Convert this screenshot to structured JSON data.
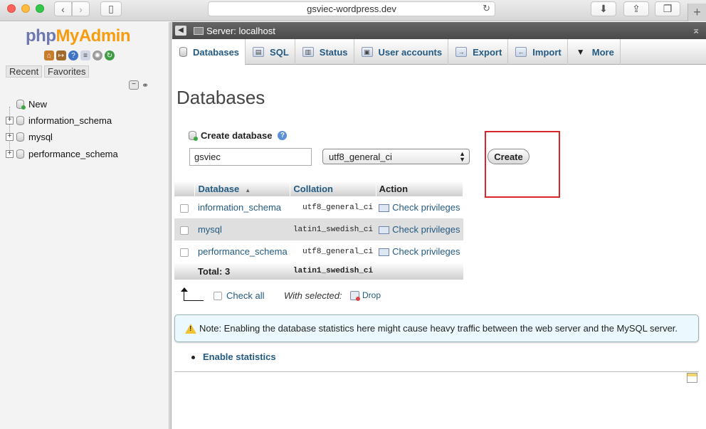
{
  "browser": {
    "url": "gsviec-wordpress.dev"
  },
  "nav": {
    "logo_php": "php",
    "logo_admin": "MyAdmin",
    "tab_recent": "Recent",
    "tab_favorites": "Favorites",
    "tree": [
      {
        "label": "New"
      },
      {
        "label": "information_schema"
      },
      {
        "label": "mysql"
      },
      {
        "label": "performance_schema"
      }
    ]
  },
  "serverbar": {
    "label": "Server: localhost"
  },
  "tabs": [
    {
      "label": "Databases",
      "icon": "database-icon",
      "active": true
    },
    {
      "label": "SQL",
      "icon": "sql-icon"
    },
    {
      "label": "Status",
      "icon": "status-icon"
    },
    {
      "label": "User accounts",
      "icon": "users-icon"
    },
    {
      "label": "Export",
      "icon": "export-icon"
    },
    {
      "label": "Import",
      "icon": "import-icon"
    },
    {
      "label": "More",
      "icon": "triangle-down-icon"
    }
  ],
  "main": {
    "title": "Databases",
    "create_label": "Create database",
    "dbname_value": "gsviec",
    "collation_value": "utf8_general_ci",
    "create_button": "Create"
  },
  "table": {
    "headers": {
      "database": "Database",
      "collation": "Collation",
      "action": "Action"
    },
    "rows": [
      {
        "name": "information_schema",
        "collation": "utf8_general_ci",
        "action": "Check privileges"
      },
      {
        "name": "mysql",
        "collation": "latin1_swedish_ci",
        "action": "Check privileges"
      },
      {
        "name": "performance_schema",
        "collation": "utf8_general_ci",
        "action": "Check privileges"
      }
    ],
    "total_label": "Total: 3",
    "total_collation": "latin1_swedish_ci"
  },
  "bulk": {
    "check_all": "Check all",
    "with_selected": "With selected:",
    "drop": "Drop"
  },
  "notice": {
    "text": "Note: Enabling the database statistics here might cause heavy traffic between the web server and the MySQL server."
  },
  "stats": {
    "link": "Enable statistics"
  },
  "colors": {
    "link": "#235a81",
    "highlight": "#d9262a",
    "logo_php": "#6c78af",
    "logo_admin": "#f89c0e"
  }
}
